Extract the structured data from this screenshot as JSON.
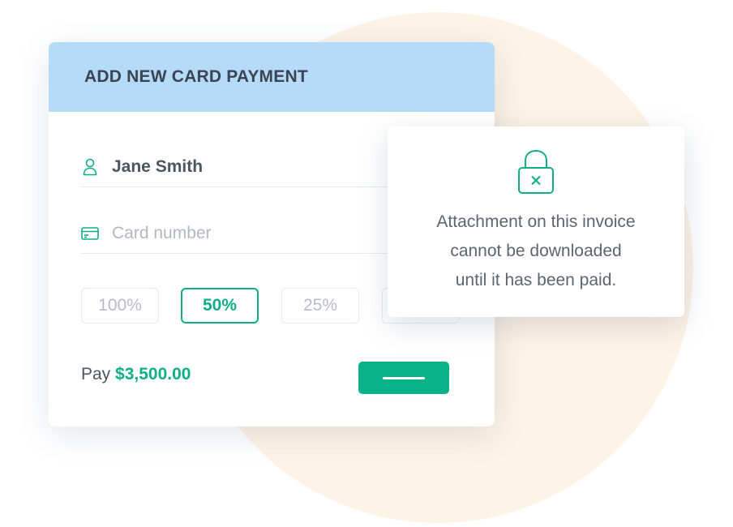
{
  "payment_card": {
    "title": "ADD NEW CARD PAYMENT",
    "name_field": {
      "value": "Jane Smith",
      "icon": "user-icon"
    },
    "card_number_field": {
      "placeholder": "Card number",
      "icon": "credit-card-icon"
    },
    "percent_options": [
      {
        "label": "100%",
        "selected": false
      },
      {
        "label": "50%",
        "selected": true
      },
      {
        "label": "25%",
        "selected": false
      },
      {
        "label": "",
        "selected": false
      }
    ],
    "pay_label": "Pay",
    "pay_amount": "$3,500.00",
    "pay_button_label": ""
  },
  "notice": {
    "icon": "locked-padlock-icon",
    "lines": [
      "Attachment on this invoice",
      "cannot be downloaded",
      "until it has been paid."
    ]
  },
  "colors": {
    "accent": "#0fae86",
    "header_bg": "#b5dbf9",
    "background_circle": "#fdf3e6"
  }
}
